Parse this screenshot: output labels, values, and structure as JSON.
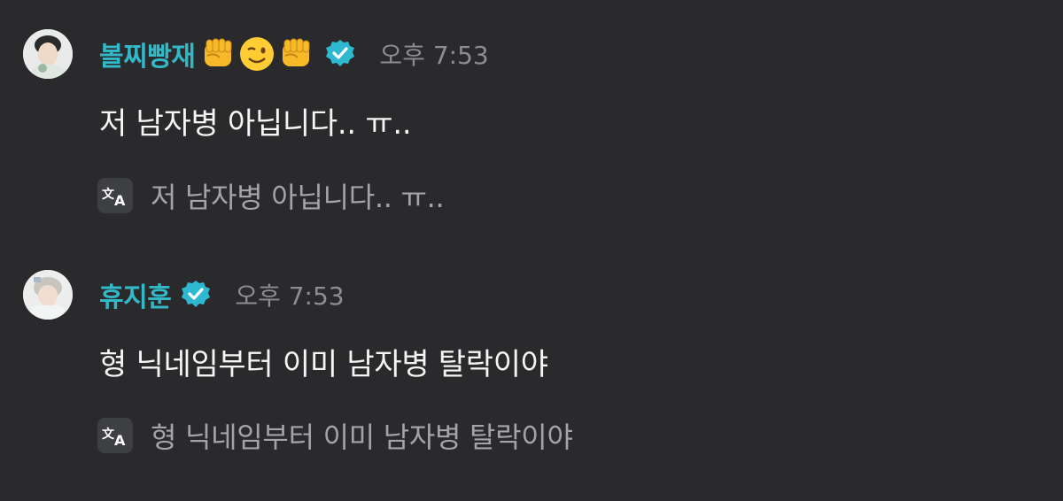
{
  "colors": {
    "background": "#2a2a2c",
    "username": "#33b8c8",
    "time": "#8b8d91",
    "message": "#f5f5f5",
    "translation": "#a3a4a8",
    "verified_badge": "#2fb9d0"
  },
  "messages": [
    {
      "username": "볼찌빵재",
      "username_emojis": [
        "raised-fist-icon",
        "winking-face-icon",
        "raised-fist-icon"
      ],
      "verified": true,
      "time": "오후 7:53",
      "text": "저 남자병 아닙니다.. ㅠ..",
      "translation_icon": "translate-icon",
      "translation": "저 남자병 아닙니다.. ㅠ.."
    },
    {
      "username": "휴지훈",
      "username_emojis": [],
      "verified": true,
      "time": "오후 7:53",
      "text": "형 닉네임부터 이미 남자병 탈락이야",
      "translation_icon": "translate-icon",
      "translation": "형 닉네임부터 이미 남자병 탈락이야"
    }
  ]
}
